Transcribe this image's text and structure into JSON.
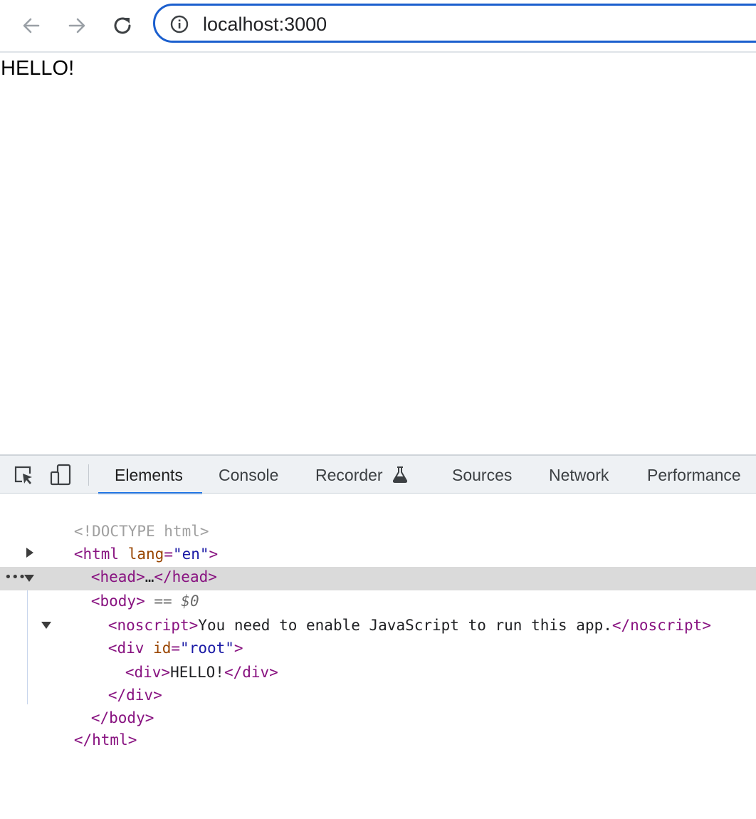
{
  "browser": {
    "url": "localhost:3000",
    "icons": {
      "back": "arrow-left-icon",
      "forward": "arrow-right-icon",
      "reload": "reload-icon",
      "site_info": "info-icon"
    }
  },
  "page": {
    "content_text": "HELLO!"
  },
  "devtools": {
    "tabs": [
      {
        "label": "Elements",
        "active": true
      },
      {
        "label": "Console",
        "active": false
      },
      {
        "label": "Recorder",
        "active": false
      },
      {
        "label": "Sources",
        "active": false
      },
      {
        "label": "Network",
        "active": false
      },
      {
        "label": "Performance",
        "active": false
      }
    ],
    "accent_color": "#1a73e8",
    "tree": {
      "doctype": "<!DOCTYPE html>",
      "html_open": {
        "tag_start": "<html",
        "attr": "lang",
        "eq": "=",
        "value": "\"en\"",
        "tag_end": ">"
      },
      "head": {
        "open": "<head>",
        "ellipsis": "…",
        "close": "</head>"
      },
      "body": {
        "open": "<body>",
        "eq_ref": " == ",
        "var": "$0"
      },
      "noscript": {
        "open": "<noscript>",
        "text": "You need to enable JavaScript to run this app.",
        "close": "</noscript>"
      },
      "div_root": {
        "tag_start": "<div",
        "attr": "id",
        "eq": "=",
        "value": "\"root\"",
        "tag_end": ">"
      },
      "inner_div": {
        "open": "<div>",
        "text": "HELLO!",
        "close": "</div>"
      },
      "div_close": "</div>",
      "body_close": "</body>",
      "html_close": "</html>",
      "dots": "•••"
    }
  }
}
